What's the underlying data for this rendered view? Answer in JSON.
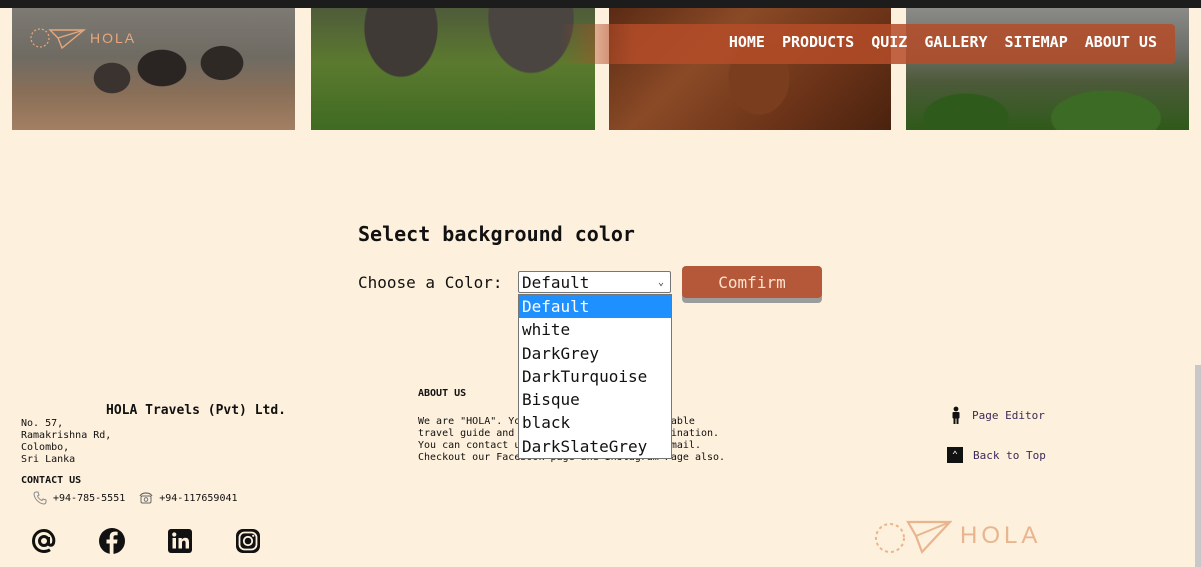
{
  "brand": {
    "name": "HOLA"
  },
  "nav": {
    "items": [
      "HOME",
      "PRODUCTS",
      "QUIZ",
      "GALLERY",
      "SITEMAP",
      "ABOUT US"
    ]
  },
  "main": {
    "heading": "Select background color",
    "choose_label": "Choose a Color:",
    "selected_value": "Default",
    "options": [
      "Default",
      "white",
      "DarkGrey",
      "DarkTurquoise",
      "Bisque",
      "black",
      "DarkSlateGrey"
    ],
    "confirm_label": "Comfirm"
  },
  "footer": {
    "company": "HOLA Travels (Pvt) Ltd.",
    "address": [
      "No. 57,",
      "Ramakrishna Rd,",
      "Colombo,",
      "Sri Lanka"
    ],
    "contact_heading": "CONTACT US",
    "phone_mobile": "+94-785-5551",
    "phone_land": "+94-117659041",
    "about_heading": "ABOUT US",
    "about_lines": [
      "We are \"HOLA\". Your best, safe and comfortable",
      "travel guide and partner to beautiful destination.",
      "You can contact us by calling or sending email.",
      "Checkout our Facebook page and Instagram Page also."
    ],
    "page_editor": "Page Editor",
    "back_to_top": "Back to Top",
    "social_icons": [
      "email-icon",
      "facebook-icon",
      "linkedin-icon",
      "instagram-icon"
    ]
  },
  "colors": {
    "background": "#fdf0dc",
    "accent": "#b5583a",
    "nav_bar": "#b54c28",
    "selected_option": "#1e90ff"
  }
}
